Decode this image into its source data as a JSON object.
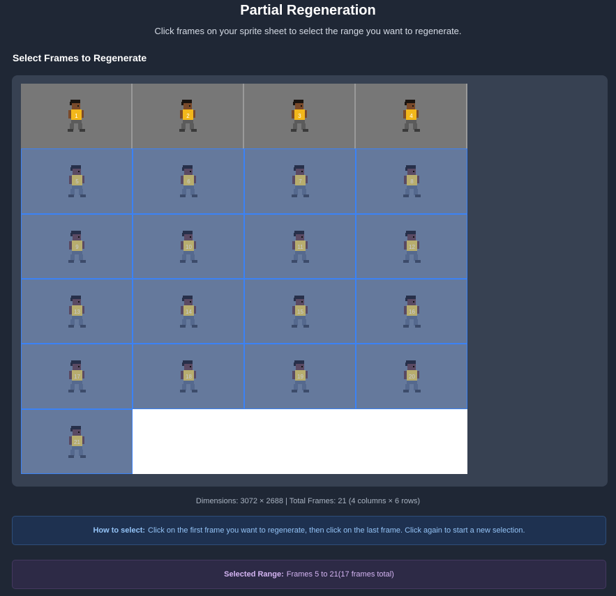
{
  "header": {
    "title": "Partial Regeneration",
    "subtitle": "Click frames on your sprite sheet to select the range you want to regenerate."
  },
  "section": {
    "heading": "Select Frames to Regenerate"
  },
  "sheet": {
    "columns": 4,
    "rows": 6,
    "frame_icon": "walking-character-sprite",
    "colors": {
      "selected_fill": "#65799c",
      "selected_border": "#3b82f6",
      "unselected_fill": "#777777"
    },
    "frames": [
      {
        "label": "1",
        "selected": false
      },
      {
        "label": "2",
        "selected": false
      },
      {
        "label": "3",
        "selected": false
      },
      {
        "label": "4",
        "selected": false
      },
      {
        "label": "5",
        "selected": true
      },
      {
        "label": "6",
        "selected": true
      },
      {
        "label": "7",
        "selected": true
      },
      {
        "label": "8",
        "selected": true
      },
      {
        "label": "9",
        "selected": true
      },
      {
        "label": "10",
        "selected": true
      },
      {
        "label": "11",
        "selected": true
      },
      {
        "label": "12",
        "selected": true
      },
      {
        "label": "13",
        "selected": true
      },
      {
        "label": "14",
        "selected": true
      },
      {
        "label": "15",
        "selected": true
      },
      {
        "label": "16",
        "selected": true
      },
      {
        "label": "17",
        "selected": true
      },
      {
        "label": "18",
        "selected": true
      },
      {
        "label": "19",
        "selected": true
      },
      {
        "label": "20",
        "selected": true
      },
      {
        "label": "21",
        "selected": true
      }
    ]
  },
  "info": {
    "dimensions_text": "Dimensions: 3072 × 2688 | Total Frames: 21 (4 columns × 6 rows)"
  },
  "help": {
    "label": "How to select:",
    "text": "Click on the first frame you want to regenerate, then click on the last frame. Click again to start a new selection."
  },
  "selection": {
    "label": "Selected Range:",
    "text": "Frames 5 to 21(17 frames total)"
  }
}
